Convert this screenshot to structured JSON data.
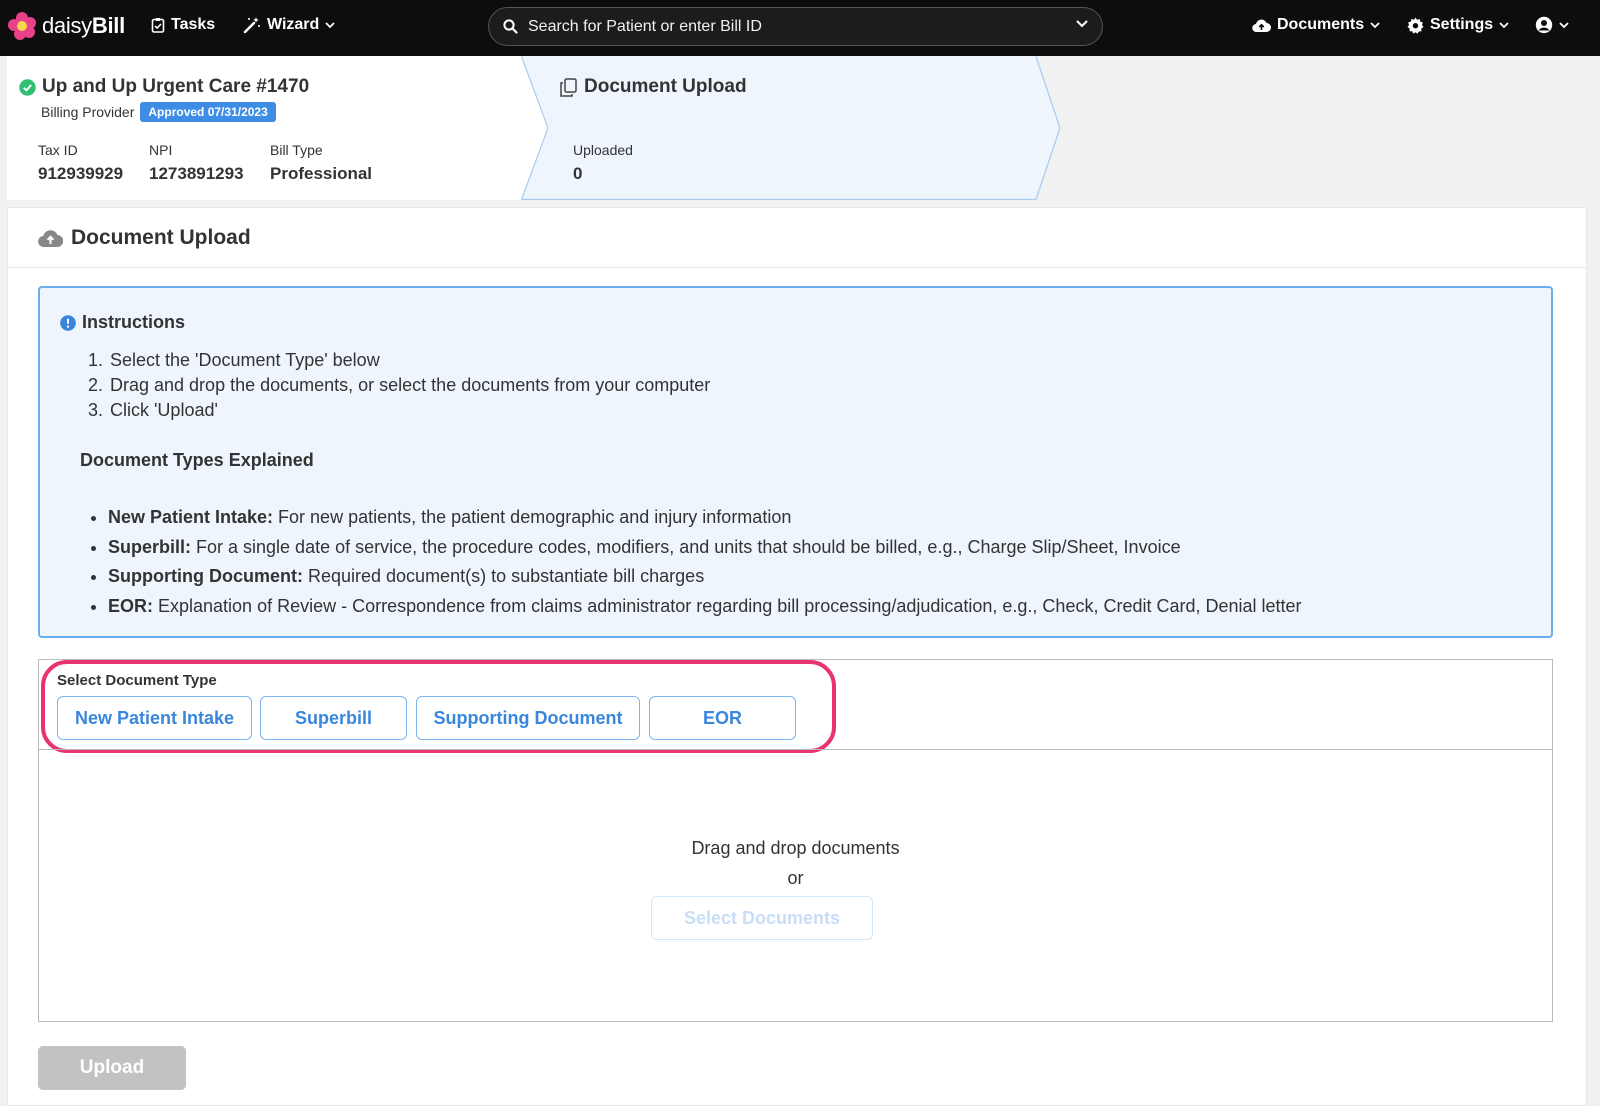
{
  "nav": {
    "brand_light": "daisy",
    "brand_bold": "Bill",
    "tasks": "Tasks",
    "wizard": "Wizard",
    "search_placeholder": "Search for Patient or enter Bill ID",
    "documents": "Documents",
    "settings": "Settings"
  },
  "provider": {
    "name": "Up and Up Urgent Care #1470",
    "role": "Billing Provider",
    "status_badge": "Approved 07/31/2023",
    "fields": [
      {
        "label": "Tax ID",
        "value": "912939929"
      },
      {
        "label": "NPI",
        "value": "1273891293"
      },
      {
        "label": "Bill Type",
        "value": "Professional"
      }
    ]
  },
  "upload_step": {
    "title": "Document Upload",
    "label": "Uploaded",
    "count": "0"
  },
  "panel": {
    "title": "Document Upload"
  },
  "instructions": {
    "title": "Instructions",
    "steps": [
      "Select the 'Document Type' below",
      "Drag and drop the documents, or select the documents from your computer",
      "Click 'Upload'"
    ],
    "types_title": "Document Types Explained",
    "types": [
      {
        "term": "New Patient Intake:",
        "desc": " For new patients, the patient demographic and injury information"
      },
      {
        "term": "Superbill:",
        "desc": " For a single date of service, the procedure codes, modifiers, and units that should be billed, e.g., Charge Slip/Sheet, Invoice"
      },
      {
        "term": "Supporting Document:",
        "desc": " Required document(s) to substantiate bill charges"
      },
      {
        "term": "EOR:",
        "desc": " Explanation of Review - Correspondence from claims administrator regarding bill processing/adjudication, e.g., Check, Credit Card, Denial letter"
      }
    ]
  },
  "doc_types": {
    "label": "Select Document Type",
    "buttons": [
      "New Patient Intake",
      "Superbill",
      "Supporting Document",
      "EOR"
    ]
  },
  "dropzone": {
    "line1": "Drag and drop documents",
    "line2": "or",
    "select_button": "Select Documents"
  },
  "upload_button": "Upload",
  "colors": {
    "nav_bg": "#0d0d0d",
    "accent_blue": "#3a86dc",
    "badge_blue": "#3d8de6",
    "highlight_pink": "#e8336e",
    "success_green": "#2fbf71",
    "disabled_gray": "#c2c2c2"
  }
}
